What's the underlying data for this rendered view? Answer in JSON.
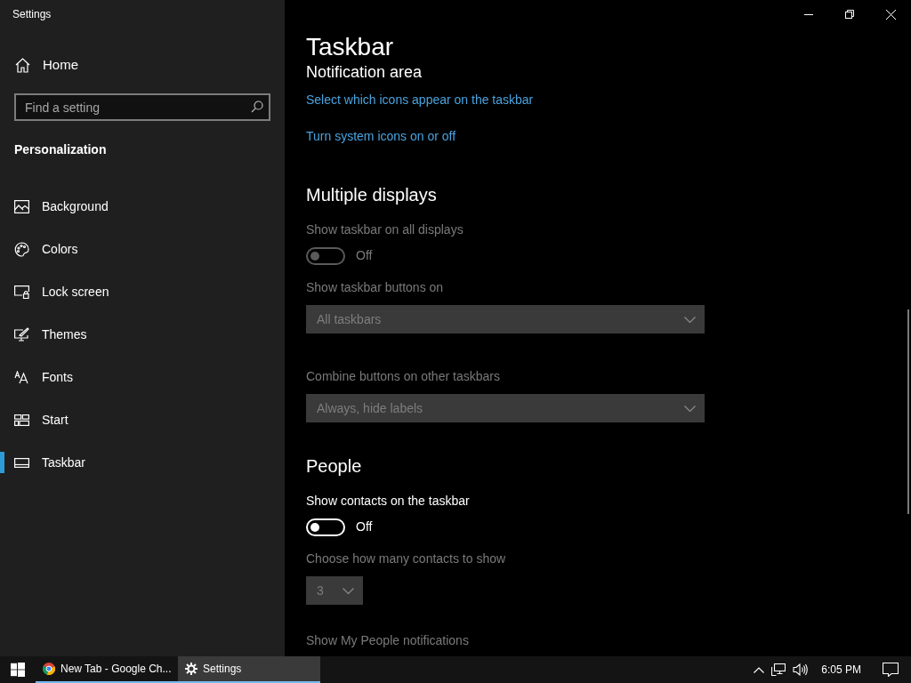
{
  "window": {
    "title": "Settings"
  },
  "sidebar": {
    "home": "Home",
    "search": {
      "placeholder": "Find a setting"
    },
    "section": "Personalization",
    "items": [
      {
        "label": "Background",
        "selected": false
      },
      {
        "label": "Colors",
        "selected": false
      },
      {
        "label": "Lock screen",
        "selected": false
      },
      {
        "label": "Themes",
        "selected": false
      },
      {
        "label": "Fonts",
        "selected": false
      },
      {
        "label": "Start",
        "selected": false
      },
      {
        "label": "Taskbar",
        "selected": true
      }
    ]
  },
  "page": {
    "title": "Taskbar",
    "clipped_heading": "Notification area",
    "links": [
      "Select which icons appear on the taskbar",
      "Turn system icons on or off"
    ],
    "sections": [
      {
        "title": "Multiple displays",
        "settings": [
          {
            "kind": "toggle",
            "label": "Show taskbar on all displays",
            "on": false,
            "disabled": true,
            "state_text": "Off"
          },
          {
            "kind": "dropdown",
            "label": "Show taskbar buttons on",
            "value": "All taskbars",
            "disabled": true
          },
          {
            "kind": "dropdown",
            "label": "Combine buttons on other taskbars",
            "value": "Always, hide labels",
            "disabled": true
          }
        ]
      },
      {
        "title": "People",
        "settings": [
          {
            "kind": "toggle",
            "label": "Show contacts on the taskbar",
            "on": false,
            "disabled": false,
            "state_text": "Off"
          },
          {
            "kind": "number",
            "label": "Choose how many contacts to show",
            "value": "3",
            "disabled": true
          },
          {
            "kind": "label",
            "label": "Show My People notifications",
            "disabled": true
          }
        ]
      }
    ]
  },
  "taskbar": {
    "apps": [
      {
        "label": "New Tab - Google Ch...",
        "selected": false
      },
      {
        "label": "Settings",
        "selected": true
      }
    ],
    "time": "6:05 PM"
  }
}
